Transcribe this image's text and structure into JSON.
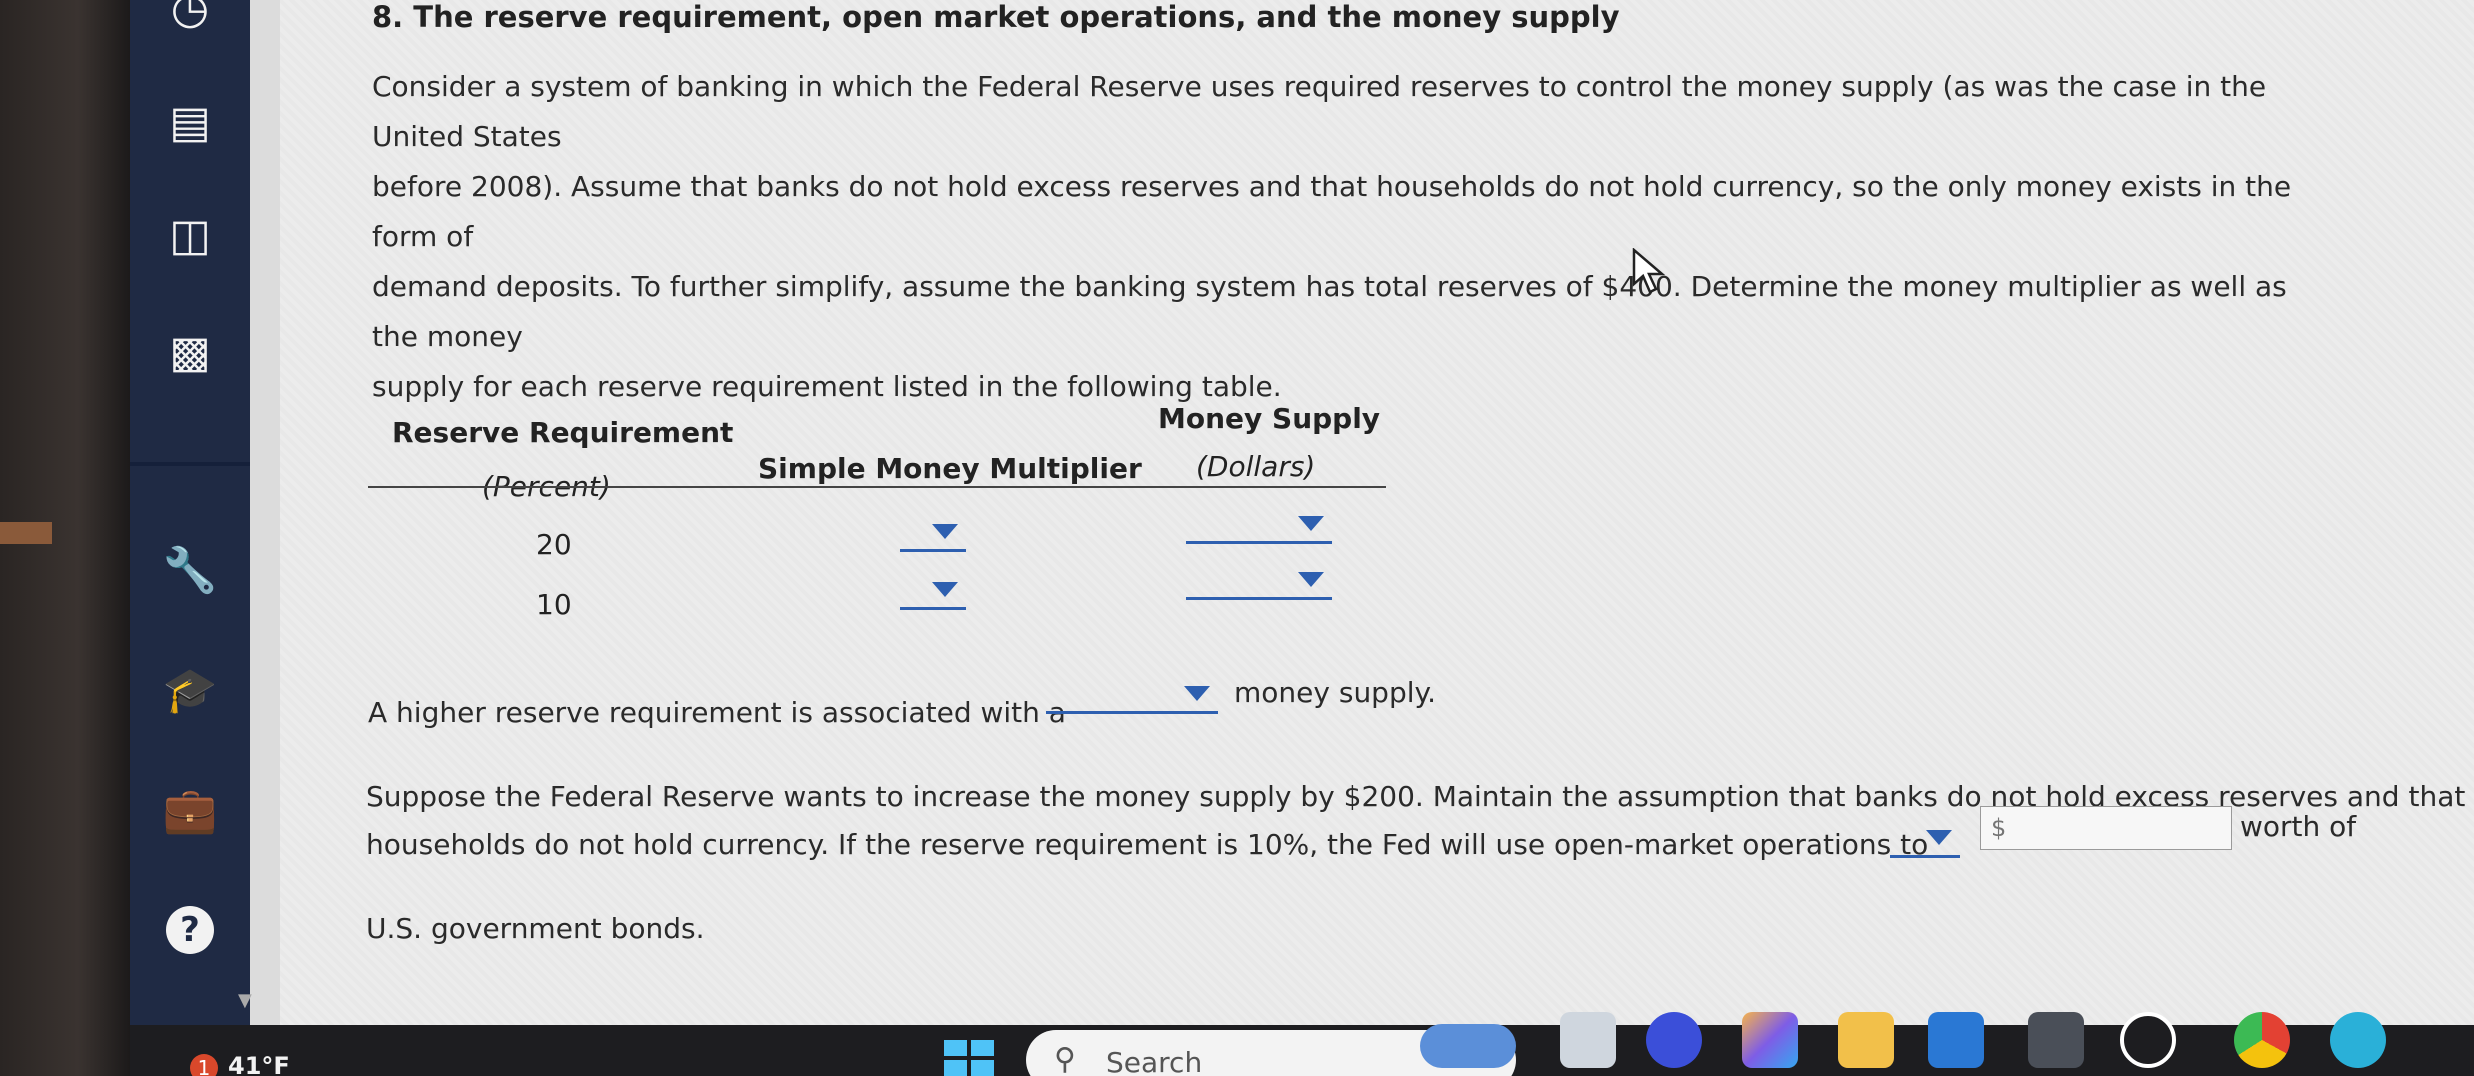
{
  "question": {
    "title": "8. The reserve requirement, open market operations, and the money supply",
    "intro_lines": [
      "Consider a system of banking in which the Federal Reserve uses required reserves to control the money supply (as was the case in the United States",
      "before 2008). Assume that banks do not hold excess reserves and that households do not hold currency, so the only money exists in the form of",
      "demand deposits. To further simplify, assume the banking system has total reserves of $400. Determine the money multiplier as well as the money",
      "supply for each reserve requirement listed in the following table."
    ]
  },
  "table": {
    "col1_header": "Reserve Requirement",
    "col1_sub": "(Percent)",
    "col2_header": "Simple Money Multiplier",
    "col3_header": "Money Supply",
    "col3_sub": "(Dollars)",
    "rows": [
      {
        "reserve": "20"
      },
      {
        "reserve": "10"
      }
    ]
  },
  "sentence1": {
    "before": "A higher reserve requirement is associated with a",
    "after": "money supply."
  },
  "sentence2": {
    "line1_before": "Suppose the Federal Reserve wants to increase the money supply by $200. Maintain the assumption that banks do not hold excess reserves and that",
    "line2_before": "households do not hold currency. If the reserve requirement is 10%, the Fed will use open-market operations to",
    "line2_after": "worth of",
    "line3": "U.S. government bonds.",
    "input_placeholder": "$"
  },
  "taskbar": {
    "weather_badge": "1",
    "weather_temp": "41°F",
    "search_label": "Search"
  },
  "colors": {
    "sidebar": "#1f2a44",
    "dropdown_accent": "#2d5fb0",
    "content_bg": "#ececec"
  }
}
